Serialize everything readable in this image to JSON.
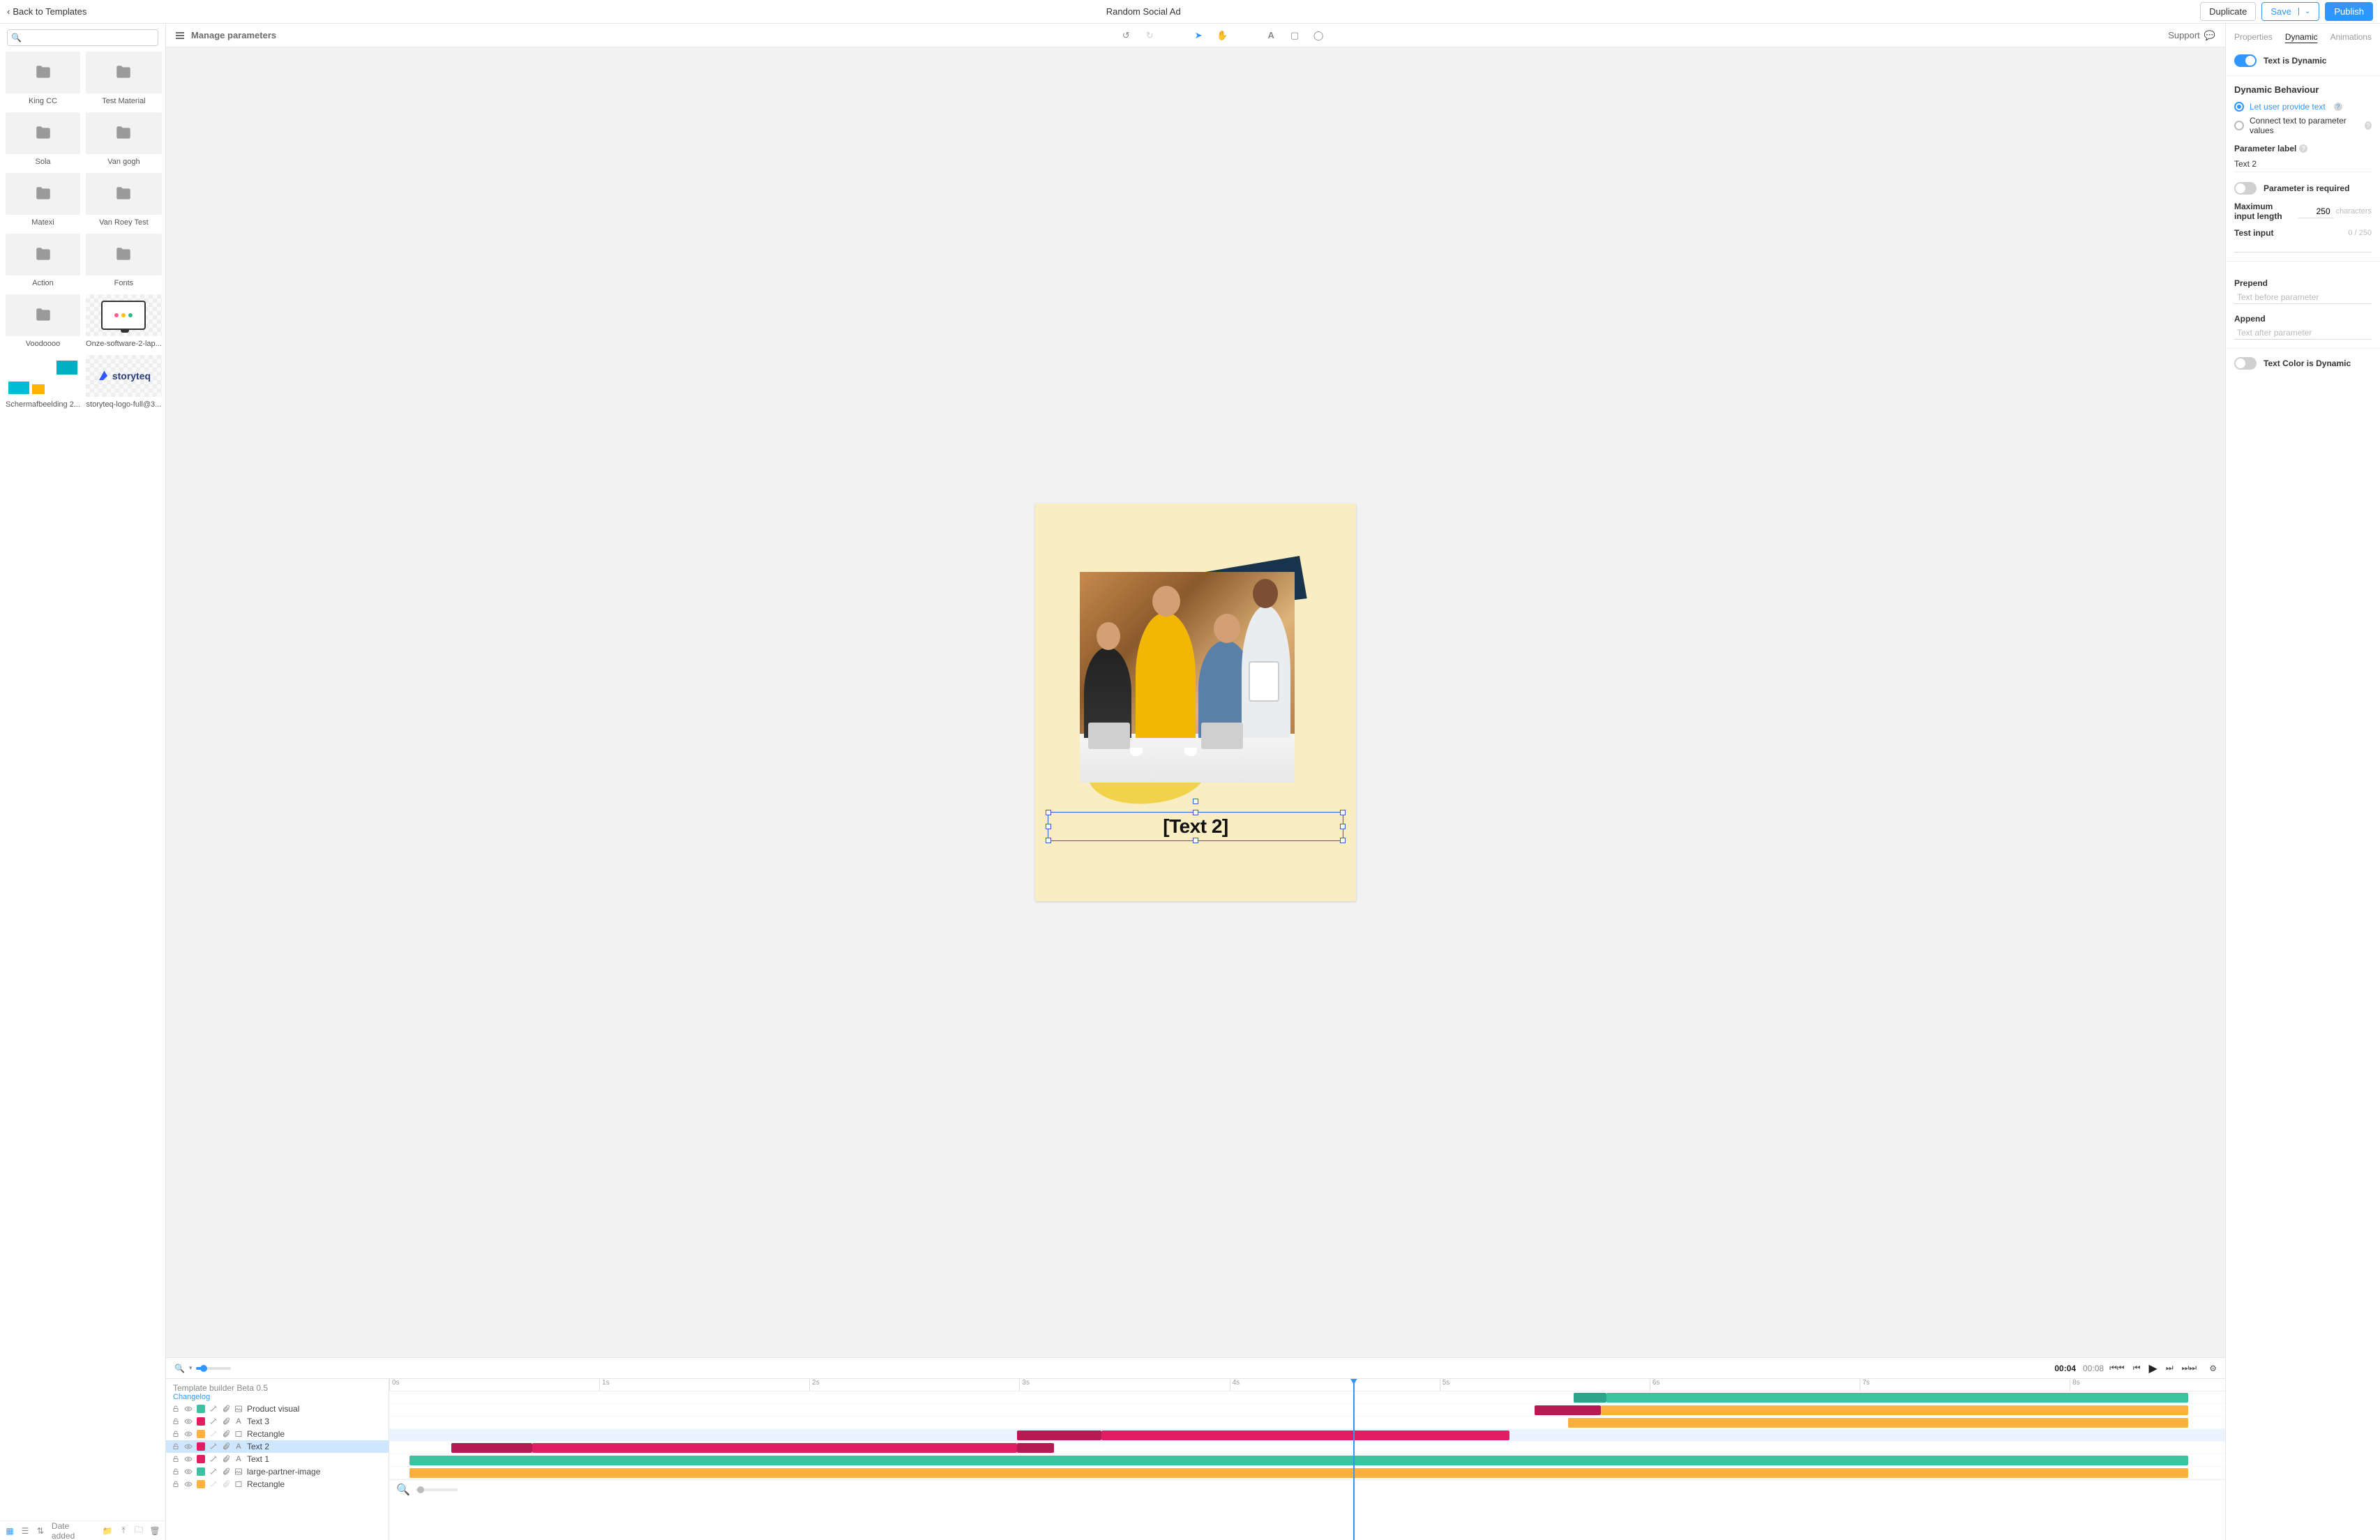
{
  "header": {
    "back_label": "Back to Templates",
    "title": "Random Social Ad",
    "duplicate": "Duplicate",
    "save": "Save",
    "publish": "Publish"
  },
  "assets": {
    "sort_label": "Date added",
    "items": [
      {
        "label": "King CC",
        "kind": "folder"
      },
      {
        "label": "Test Material",
        "kind": "folder"
      },
      {
        "label": "Sola",
        "kind": "folder"
      },
      {
        "label": "Van gogh",
        "kind": "folder"
      },
      {
        "label": "Matexi",
        "kind": "folder"
      },
      {
        "label": "Van Roey Test",
        "kind": "folder"
      },
      {
        "label": "Action",
        "kind": "folder"
      },
      {
        "label": "Fonts",
        "kind": "folder"
      },
      {
        "label": "Voodoooo",
        "kind": "folder"
      },
      {
        "label": "Onze-software-2-lap...",
        "kind": "device"
      },
      {
        "label": "Schermafbeelding 2...",
        "kind": "scherm"
      },
      {
        "label": "storyteq-logo-full@3...",
        "kind": "storyteq"
      }
    ]
  },
  "center_toolbar": {
    "manage": "Manage parameters",
    "support": "Support"
  },
  "canvas": {
    "selected_text": "[Text 2]"
  },
  "playbar": {
    "current": "00:04",
    "total": "00:08"
  },
  "timeline": {
    "title": "Template builder Beta 0.5",
    "changelog": "Changelog",
    "ticks": [
      "0s",
      "1s",
      "2s",
      "3s",
      "4s",
      "5s",
      "6s",
      "7s",
      "8s"
    ],
    "playhead_pct": 52.5,
    "layers": [
      {
        "name": "Product visual",
        "color": "#3cc1a1",
        "type": "image",
        "fx": true,
        "fx2": true,
        "bars": [
          {
            "l": 64.5,
            "w": 1.8,
            "c": "#2da58b"
          },
          {
            "l": 66.3,
            "w": 31.7,
            "c": "#3cc1a1"
          }
        ]
      },
      {
        "name": "Text 3",
        "color": "#e21e63",
        "type": "text",
        "fx": true,
        "fx2": true,
        "bars": [
          {
            "l": 62.4,
            "w": 3.6,
            "c": "#b71a52"
          },
          {
            "l": 66,
            "w": 32,
            "c": "#fbb040"
          }
        ]
      },
      {
        "name": "Rectangle",
        "color": "#fbb040",
        "type": "rect",
        "fx": false,
        "fx2": true,
        "bars": [
          {
            "l": 64.2,
            "w": 33.8,
            "c": "#fbb040"
          }
        ]
      },
      {
        "name": "Text 2",
        "color": "#e21e63",
        "type": "text",
        "fx": true,
        "fx2": true,
        "selected": true,
        "bars": [
          {
            "l": 34.2,
            "w": 4.6,
            "c": "#b71a52"
          },
          {
            "l": 38.8,
            "w": 22.2,
            "c": "#e21e63"
          }
        ]
      },
      {
        "name": "Text 1",
        "color": "#e21e63",
        "type": "text",
        "fx": true,
        "fx2": true,
        "bars": [
          {
            "l": 3.4,
            "w": 4.4,
            "c": "#b71a52"
          },
          {
            "l": 7.8,
            "w": 26.4,
            "c": "#e21e63"
          },
          {
            "l": 34.2,
            "w": 2,
            "c": "#b71a52"
          }
        ]
      },
      {
        "name": "large-partner-image",
        "color": "#3cc1a1",
        "type": "image",
        "fx": true,
        "fx2": true,
        "bars": [
          {
            "l": 1.1,
            "w": 96.9,
            "c": "#3cc1a1"
          }
        ]
      },
      {
        "name": "Rectangle",
        "color": "#fbb040",
        "type": "rect",
        "fx": false,
        "fx2": false,
        "bars": [
          {
            "l": 1.1,
            "w": 96.9,
            "c": "#fbb040"
          }
        ]
      }
    ]
  },
  "right": {
    "tabs": {
      "properties": "Properties",
      "dynamic": "Dynamic",
      "animations": "Animations"
    },
    "text_is_dynamic": "Text is Dynamic",
    "behaviour_heading": "Dynamic Behaviour",
    "opt_user_text": "Let user provide text",
    "opt_connect": "Connect text to parameter values",
    "param_label": "Parameter label",
    "param_value": "Text 2",
    "param_required": "Parameter is required",
    "max_len_label": "Maximum input length",
    "max_len_value": "250",
    "characters": "characters",
    "test_input_label": "Test input",
    "test_input_count": "0 / 250",
    "prepend_label": "Prepend",
    "prepend_placeholder": "Text before parameter",
    "append_label": "Append",
    "append_placeholder": "Text after parameter",
    "color_dynamic": "Text Color is Dynamic"
  }
}
